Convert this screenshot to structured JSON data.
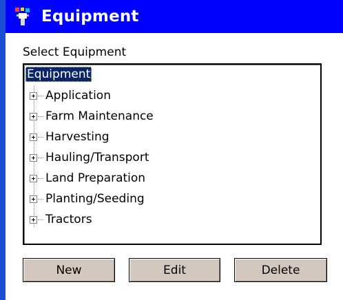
{
  "header": {
    "title": "Equipment",
    "icon": "equipment-app-icon",
    "background_color": "#0000ff"
  },
  "select_label": "Select Equipment",
  "tree": {
    "root_label": "Equipment",
    "items": [
      {
        "label": "Application"
      },
      {
        "label": "Farm Maintenance"
      },
      {
        "label": "Harvesting"
      },
      {
        "label": "Hauling/Transport"
      },
      {
        "label": "Land Preparation"
      },
      {
        "label": "Planting/Seeding"
      },
      {
        "label": "Tractors"
      }
    ]
  },
  "buttons": {
    "new_label": "New",
    "edit_label": "Edit",
    "delete_label": "Delete"
  }
}
